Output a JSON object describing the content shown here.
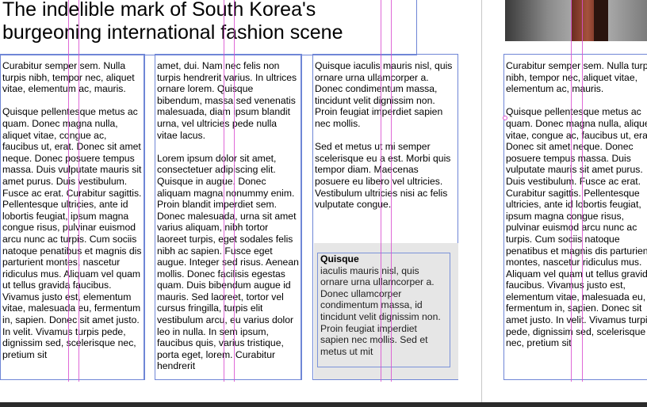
{
  "headline": {
    "text": "The indelible mark of South Korea's\nburgeoning international fashion scene"
  },
  "columns": {
    "col1": [
      "Curabitur semper sem. Nulla turpis nibh, tempor nec, aliquet vitae, elementum ac, mauris.",
      "Quisque pellentesque metus ac quam. Donec magna nulla, aliquet vitae, congue ac, faucibus ut, erat. Donec sit amet neque. Donec posuere tempus massa. Duis vulputate mauris sit amet purus. Duis vestibulum. Fusce ac erat. Curabitur sagittis. Pellentesque ultricies, ante id lobortis feugiat, ipsum magna congue risus, pulvinar euismod arcu nunc ac turpis. Cum sociis natoque penatibus et magnis dis parturient montes, nascetur ridiculus mus. Aliquam vel quam ut tellus gravida faucibus. Vivamus justo est, elementum vitae, malesuada eu, fermentum in, sapien. Donec sit amet justo. In velit. Vivamus turpis pede, dignissim sed, scelerisque nec, pretium sit"
    ],
    "col2": [
      "amet, dui. Nam nec felis non turpis hendrerit varius. In ultrices ornare lorem. Quisque bibendum, massa sed venenatis malesuada, diam ipsum blandit urna, vel ultricies pede nulla vitae lacus.",
      "Lorem ipsum dolor sit amet, consectetuer adipiscing elit. Quisque in augue. Donec aliquam magna nonummy enim. Proin blandit imperdiet sem. Donec malesuada, urna sit amet varius aliquam, nibh tortor laoreet turpis, eget sodales felis nibh ac sapien. Fusce eget augue. Integer sed risus. Aenean mollis. Donec facilisis egestas quam. Duis bibendum augue id mauris. Sed laoreet, tortor vel cursus fringilla, turpis elit vestibulum arcu, eu varius dolor leo in nulla. In sem ipsum, faucibus quis, varius tristique, porta eget, lorem. Curabitur hendrerit"
    ],
    "col3": [
      "Quisque iaculis mauris nisl, quis ornare urna ullamcorper a. Donec condimentum massa, tincidunt velit dignissim non. Proin feugiat imperdiet sapien nec mollis.",
      "Sed et metus ut mi semper scelerisque eu a est. Morbi quis tempor diam. Maecenas posuere eu libero vel ultricies. Vestibulum ultricies nisi ac felis vulputate congue."
    ],
    "col4": [
      "Curabitur semper sem. Nulla turpis nibh, tempor nec, aliquet vitae, elementum ac, mauris.",
      "Quisque pellentesque metus ac quam. Donec magna nulla, aliquet vitae, congue ac, faucibus ut, erat. Donec sit amet neque. Donec posuere tempus massa. Duis vulputate mauris sit amet purus. Duis vestibulum. Fusce ac erat. Curabitur sagittis. Pellentesque ultricies, ante id lobortis feugiat, ipsum magna congue risus, pulvinar euismod arcu nunc ac turpis. Cum sociis natoque penatibus et magnis dis parturient montes, nascetur ridiculus mus. Aliquam vel quam ut tellus gravida faucibus. Vivamus justo est, elementum vitae, malesuada eu, fermentum in, sapien. Donec sit amet justo. In velit. Vivamus turpis pede, dignissim sed, scelerisque nec, pretium sit"
    ]
  },
  "sidebar": {
    "title": "Quisque",
    "body": "iaculis mauris nisl, quis ornare urna ullamcorper a. Donec ullamcorper condimentum massa, id tincidunt velit dignissim non. Proin feugiat imperdiet sapien nec mollis. Sed et metus ut mit"
  },
  "colors": {
    "frame_edge": "#6f86d6",
    "guide": "#d94fd0",
    "sidebar_fill": "#e6e6e6"
  }
}
